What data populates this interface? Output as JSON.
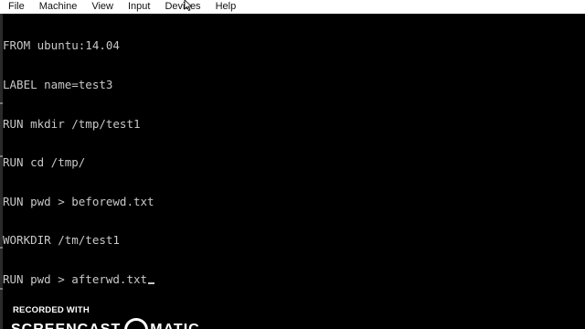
{
  "menubar": {
    "items": [
      {
        "label": "File"
      },
      {
        "label": "Machine"
      },
      {
        "label": "View"
      },
      {
        "label": "Input"
      },
      {
        "label": "Devices"
      },
      {
        "label": "Help"
      }
    ]
  },
  "terminal": {
    "lines": [
      "FROM ubuntu:14.04",
      "LABEL name=test3",
      "RUN mkdir /tmp/test1",
      "RUN cd /tmp/",
      "RUN pwd > beforewd.txt",
      "WORKDIR /tm/test1",
      "RUN pwd > afterwd.txt"
    ],
    "text_color": "#c8c8c8",
    "background": "#000000"
  },
  "watermark": {
    "line1": "RECORDED WITH",
    "line2_part1": "SCREENCAST",
    "line2_part2": "MATIC"
  },
  "icons": {
    "mouse_cursor": "arrow-cursor-icon",
    "watermark_logo": "screencast-logo-icon"
  }
}
